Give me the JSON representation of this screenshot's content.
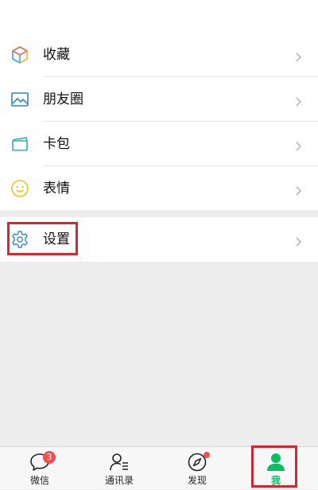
{
  "menu": {
    "items": [
      {
        "label": "收藏",
        "icon": "favorites-cube-icon"
      },
      {
        "label": "朋友圈",
        "icon": "moments-image-icon"
      },
      {
        "label": "卡包",
        "icon": "cards-wallet-icon"
      },
      {
        "label": "表情",
        "icon": "sticker-smiley-icon"
      }
    ],
    "settings": {
      "label": "设置",
      "icon": "gear-icon"
    }
  },
  "tabbar": {
    "tabs": [
      {
        "label": "微信",
        "icon": "chat-bubble-icon",
        "badge": "3"
      },
      {
        "label": "通讯录",
        "icon": "contacts-icon"
      },
      {
        "label": "发现",
        "icon": "compass-icon",
        "dot": true
      },
      {
        "label": "我",
        "icon": "person-icon",
        "active": true
      }
    ]
  },
  "colors": {
    "accent": "#07c160",
    "highlight": "#d7262e",
    "badge": "#f04f4f",
    "background": "#ededed"
  }
}
